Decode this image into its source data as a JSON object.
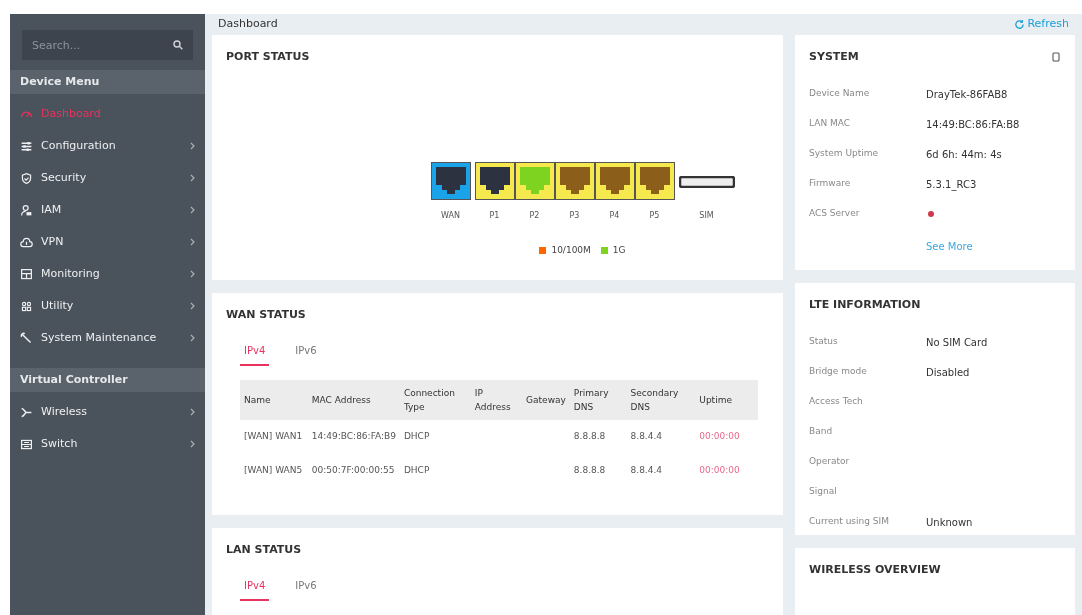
{
  "sidebar": {
    "search": {
      "placeholder": "Search..."
    },
    "sections": [
      {
        "title": "Device Menu",
        "items": [
          {
            "label": "Dashboard",
            "kind": "link",
            "selected": true
          },
          {
            "label": "Configuration",
            "kind": "submenu",
            "selected": false
          },
          {
            "label": "Security",
            "kind": "submenu",
            "selected": false
          },
          {
            "label": "IAM",
            "kind": "submenu",
            "selected": false
          },
          {
            "label": "VPN",
            "kind": "submenu",
            "selected": false
          },
          {
            "label": "Monitoring",
            "kind": "submenu",
            "selected": false
          },
          {
            "label": "Utility",
            "kind": "submenu",
            "selected": false
          },
          {
            "label": "System Maintenance",
            "kind": "submenu",
            "selected": false
          }
        ]
      },
      {
        "title": "Virtual Controller",
        "items": [
          {
            "label": "Wireless",
            "kind": "submenu",
            "selected": false
          },
          {
            "label": "Switch",
            "kind": "submenu",
            "selected": false
          }
        ]
      }
    ]
  },
  "header": {
    "title": "Dashboard",
    "refresh": "Refresh"
  },
  "port_status": {
    "title": "PORT STATUS",
    "ports": [
      {
        "label": "WAN",
        "kind": "wan",
        "color": "#2d3240"
      },
      {
        "label": "P1",
        "kind": "lan",
        "color": "#2d3240"
      },
      {
        "label": "P2",
        "kind": "lan",
        "color": "#7ed321"
      },
      {
        "label": "P3",
        "kind": "lan",
        "color": "#8b5e1a"
      },
      {
        "label": "P4",
        "kind": "lan",
        "color": "#8b5e1a"
      },
      {
        "label": "P5",
        "kind": "lan",
        "color": "#8b5e1a"
      },
      {
        "label": "SIM",
        "kind": "sim"
      }
    ],
    "legend": [
      {
        "label": "10/100M",
        "color": "#ff6600"
      },
      {
        "label": "1G",
        "color": "#7ed321"
      }
    ]
  },
  "wan_status": {
    "title": "WAN STATUS",
    "tabs": [
      {
        "label": "IPv4",
        "selected": true
      },
      {
        "label": "IPv6",
        "selected": false
      }
    ],
    "columns": [
      "Name",
      "MAC Address",
      "Connection Type",
      "IP Address",
      "Gateway",
      "Primary DNS",
      "Secondary DNS",
      "Uptime"
    ],
    "rows": [
      [
        "[WAN] WAN1",
        "14:49:BC:86:FA:B9",
        "DHCP",
        "",
        "",
        "8.8.8.8",
        "8.8.4.4",
        "00:00:00"
      ],
      [
        "[WAN] WAN5",
        "00:50:7F:00:00:55",
        "DHCP",
        "",
        "",
        "8.8.8.8",
        "8.8.4.4",
        "00:00:00"
      ]
    ]
  },
  "lan_status": {
    "title": "LAN STATUS",
    "tabs": [
      {
        "label": "IPv4",
        "selected": true
      },
      {
        "label": "IPv6",
        "selected": false
      }
    ]
  },
  "system": {
    "title": "SYSTEM",
    "rows": [
      {
        "label": "Device Name",
        "value": "DrayTek-86FAB8"
      },
      {
        "label": "LAN MAC",
        "value": "14:49:BC:86:FA:B8"
      },
      {
        "label": "System Uptime",
        "value": "6d 6h: 44m: 4s"
      },
      {
        "label": "Firmware",
        "value": "5.3.1_RC3"
      },
      {
        "label": "ACS Server",
        "connected": false
      }
    ],
    "see_more": "See More"
  },
  "lte": {
    "title": "LTE INFORMATION",
    "rows": [
      {
        "label": "Status",
        "value": "No SIM Card"
      },
      {
        "label": "Bridge mode",
        "value": "Disabled"
      },
      {
        "label": "Access Tech"
      },
      {
        "label": "Band"
      },
      {
        "label": "Operator"
      },
      {
        "label": "Signal"
      },
      {
        "label": "Current using SIM",
        "value": "Unknown"
      }
    ]
  },
  "wireless_overview": {
    "title": "WIRELESS OVERVIEW"
  }
}
